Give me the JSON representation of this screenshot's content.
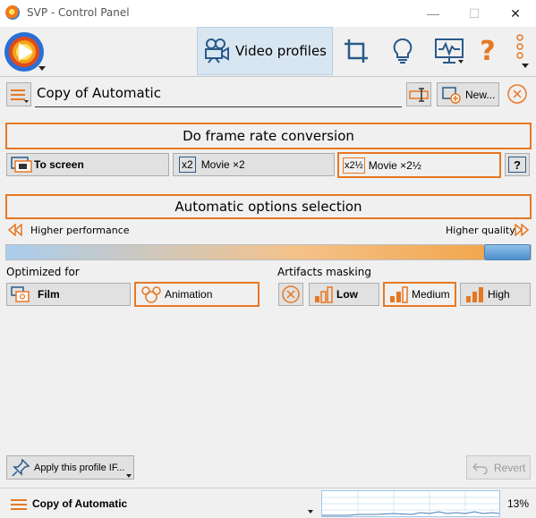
{
  "window": {
    "title": "SVP - Control Panel",
    "min": "—",
    "max": "☐",
    "close": "✕"
  },
  "toolbar": {
    "video_profiles_label": "Video profiles",
    "help_glyph": "?",
    "icons": [
      "svp-logo-icon",
      "camera-icon",
      "crop-icon",
      "lightbulb-icon",
      "monitor-icon",
      "help-icon",
      "more-icon"
    ]
  },
  "profile": {
    "name": "Copy of Automatic",
    "new_label": "New..."
  },
  "frame_rate": {
    "header": "Do frame rate conversion",
    "to_screen": "To screen",
    "movie_x2_prefix": "x2",
    "movie_x2": "Movie ×2",
    "movie_x25_prefix": "x2½",
    "movie_x25": "Movie ×2½",
    "question": "?"
  },
  "auto": {
    "header": "Automatic options selection",
    "left_label": "Higher performance",
    "right_label": "Higher quality",
    "slider_level": 1.0
  },
  "optimized": {
    "label": "Optimized for",
    "film": "Film",
    "animation": "Animation"
  },
  "artifacts": {
    "label": "Artifacts masking",
    "low": "Low",
    "medium": "Medium",
    "high": "High"
  },
  "bottom": {
    "apply_label": "Apply this profile IF...",
    "revert_label": "Revert"
  },
  "status": {
    "profile_name": "Copy of Automatic",
    "cpu": "13%"
  },
  "colors": {
    "accent": "#e87722",
    "active_tab": "#d8e6f2",
    "slider_blue": "#6fa8dc"
  }
}
